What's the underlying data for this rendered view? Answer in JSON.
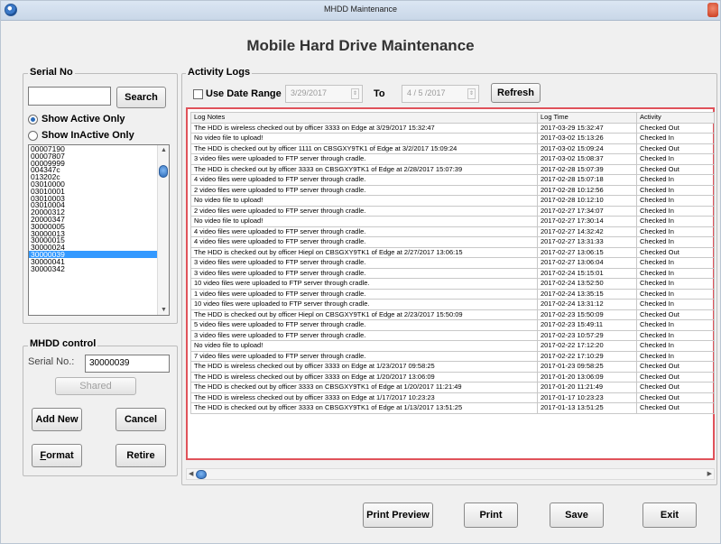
{
  "window": {
    "title": "MHDD Maintenance",
    "heading": "Mobile Hard Drive Maintenance"
  },
  "serial_panel": {
    "group_label": "Serial No",
    "search_value": "",
    "search_button": "Search",
    "show_active_label": "Show Active Only",
    "show_inactive_label": "Show InActive Only",
    "selected_filter": "active",
    "serials": [
      "00007190",
      "00007807",
      "00009999",
      "004347c",
      "013202c",
      "03010000",
      "03010001",
      "03010003",
      "03010004",
      "20000312",
      "20000347",
      "30000005",
      "30000013",
      "30000015",
      "30000024",
      "30000039",
      "30000041",
      "30000342"
    ],
    "selected_serial": "30000039"
  },
  "mhdd_control": {
    "group_label": "MHDD control",
    "serial_label": "Serial No.:",
    "serial_value": "30000039",
    "shared_button": "Shared",
    "add_new_button": "Add New",
    "cancel_button": "Cancel",
    "format_button_underlined": "F",
    "format_button_rest": "ormat",
    "retire_button": "Retire"
  },
  "activity_logs": {
    "group_label": "Activity Logs",
    "use_date_range_label": "Use Date Range",
    "from_date": "3/29/2017",
    "to_label": "To",
    "to_date": "4 / 5 /2017",
    "refresh_button": "Refresh",
    "columns": [
      "Log Notes",
      "Log Time",
      "Activity"
    ],
    "rows": [
      [
        "The HDD is wireless checked out by officer 3333 on Edge at 3/29/2017 15:32:47",
        "2017-03-29 15:32:47",
        "Checked Out"
      ],
      [
        "No video file to upload!",
        "2017-03-02 15:13:26",
        "Checked In"
      ],
      [
        "The HDD is checked out by officer 1111 on CBSGXY9TK1 of Edge at 3/2/2017 15:09:24",
        "2017-03-02 15:09:24",
        "Checked Out"
      ],
      [
        "3 video files were uploaded to FTP server through cradle.",
        "2017-03-02 15:08:37",
        "Checked In"
      ],
      [
        "The HDD is checked out by officer 3333 on CBSGXY9TK1 of Edge at 2/28/2017 15:07:39",
        "2017-02-28 15:07:39",
        "Checked Out"
      ],
      [
        "4 video files were uploaded to FTP server through cradle.",
        "2017-02-28 15:07:18",
        "Checked In"
      ],
      [
        "2 video files were uploaded to FTP server through cradle.",
        "2017-02-28 10:12:56",
        "Checked In"
      ],
      [
        "No video file to upload!",
        "2017-02-28 10:12:10",
        "Checked In"
      ],
      [
        "2 video files were uploaded to FTP server through cradle.",
        "2017-02-27 17:34:07",
        "Checked In"
      ],
      [
        "No video file to upload!",
        "2017-02-27 17:30:14",
        "Checked In"
      ],
      [
        "4 video files were uploaded to FTP server through cradle.",
        "2017-02-27 14:32:42",
        "Checked In"
      ],
      [
        "4 video files were uploaded to FTP server through cradle.",
        "2017-02-27 13:31:33",
        "Checked In"
      ],
      [
        "The HDD is checked out by officer Hiepl on CBSGXY9TK1 of Edge at 2/27/2017 13:06:15",
        "2017-02-27 13:06:15",
        "Checked Out"
      ],
      [
        "3 video files were uploaded to FTP server through cradle.",
        "2017-02-27 13:06:04",
        "Checked In"
      ],
      [
        "3 video files were uploaded to FTP server through cradle.",
        "2017-02-24 15:15:01",
        "Checked In"
      ],
      [
        "10 video files were uploaded to FTP server through cradle.",
        "2017-02-24 13:52:50",
        "Checked In"
      ],
      [
        "1 video files were uploaded to FTP server through cradle.",
        "2017-02-24 13:35:15",
        "Checked In"
      ],
      [
        "10 video files were uploaded to FTP server through cradle.",
        "2017-02-24 13:31:12",
        "Checked In"
      ],
      [
        "The HDD is checked out by officer Hiepl on CBSGXY9TK1 of Edge at 2/23/2017 15:50:09",
        "2017-02-23 15:50:09",
        "Checked Out"
      ],
      [
        "5 video files were uploaded to FTP server through cradle.",
        "2017-02-23 15:49:11",
        "Checked In"
      ],
      [
        "3 video files were uploaded to FTP server through cradle.",
        "2017-02-23 10:57:29",
        "Checked In"
      ],
      [
        "No video file to upload!",
        "2017-02-22 17:12:20",
        "Checked In"
      ],
      [
        "7 video files were uploaded to FTP server through cradle.",
        "2017-02-22 17:10:29",
        "Checked In"
      ],
      [
        "The HDD is wireless checked out by officer 3333 on Edge at 1/23/2017 09:58:25",
        "2017-01-23 09:58:25",
        "Checked Out"
      ],
      [
        "The HDD is wireless checked out by officer 3333 on Edge at 1/20/2017 13:06:09",
        "2017-01-20 13:06:09",
        "Checked Out"
      ],
      [
        "The HDD is checked out by officer 3333 on CBSGXY9TK1 of Edge at 1/20/2017 11:21:49",
        "2017-01-20 11:21:49",
        "Checked Out"
      ],
      [
        "The HDD is wireless checked out by officer 3333 on Edge at 1/17/2017 10:23:23",
        "2017-01-17 10:23:23",
        "Checked Out"
      ],
      [
        "The HDD is checked out by officer 3333 on CBSGXY9TK1 of Edge at 1/13/2017 13:51:25",
        "2017-01-13 13:51:25",
        "Checked Out"
      ]
    ]
  },
  "bottom_bar": {
    "print_preview_button": "Print Preview",
    "print_button": "Print",
    "save_button": "Save",
    "exit_button": "Exit"
  },
  "colors": {
    "highlight_border": "#e0525a",
    "selection": "#3399ff",
    "scroll_thumb": "#2a6ab8"
  }
}
